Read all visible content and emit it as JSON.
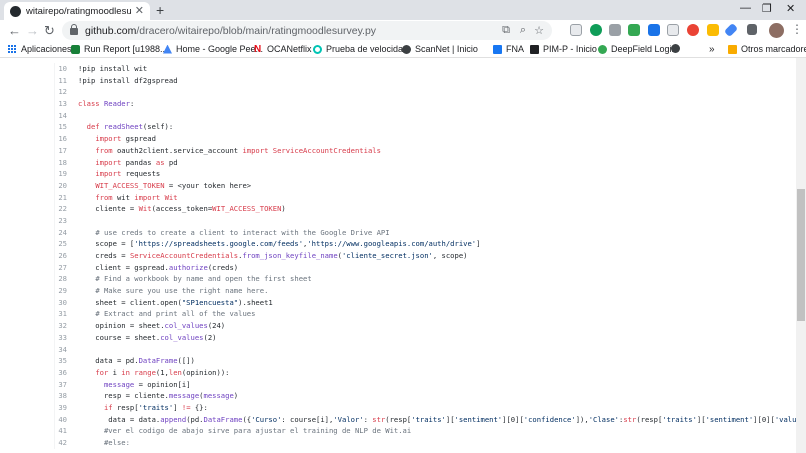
{
  "browser": {
    "tab_title": "witairepo/ratingmoodlesurvey.py",
    "url_host": "github.com",
    "url_path": "/dracero/witairepo/blob/main/ratingmoodlesurvey.py"
  },
  "bookmarks": [
    {
      "label": "Aplicaciones",
      "icon": "apps-grid-icon"
    },
    {
      "label": "Run Report [u1988...",
      "icon": "report-icon"
    },
    {
      "label": "Home - Google Pee...",
      "icon": "home-icon"
    },
    {
      "label": "OCANetflix",
      "icon": "netflix-icon"
    },
    {
      "label": "Prueba de velocida...",
      "icon": "speedtest-icon"
    },
    {
      "label": "ScanNet | Inicio",
      "icon": "scannet-icon"
    },
    {
      "label": "FNA",
      "icon": "facebook-icon"
    },
    {
      "label": "PIM-P - Inicio",
      "icon": "pim-icon"
    },
    {
      "label": "DeepField Login",
      "icon": "deepfield-icon"
    },
    {
      "label": "Otros marcadores",
      "icon": "folder-icon"
    }
  ],
  "code": {
    "lines": [
      {
        "n": "10",
        "text": "!pip install wit"
      },
      {
        "n": "11",
        "text": "!pip install df2gspread"
      },
      {
        "n": "12",
        "text": ""
      },
      {
        "n": "13",
        "text": "class Reader:"
      },
      {
        "n": "14",
        "text": ""
      },
      {
        "n": "15",
        "text": "  def readSheet(self):"
      },
      {
        "n": "16",
        "text": "    import gspread"
      },
      {
        "n": "17",
        "text": "    from oauth2client.service_account import ServiceAccountCredentials"
      },
      {
        "n": "18",
        "text": "    import pandas as pd"
      },
      {
        "n": "19",
        "text": "    import requests"
      },
      {
        "n": "20",
        "text": "    WIT_ACCESS_TOKEN = <your token here>"
      },
      {
        "n": "21",
        "text": "    from wit import Wit"
      },
      {
        "n": "22",
        "text": "    cliente = Wit(access_token=WIT_ACCESS_TOKEN)"
      },
      {
        "n": "23",
        "text": ""
      },
      {
        "n": "24",
        "text": "    # use creds to create a client to interact with the Google Drive API"
      },
      {
        "n": "25",
        "text": "    scope = ['https://spreadsheets.google.com/feeds','https://www.googleapis.com/auth/drive']"
      },
      {
        "n": "26",
        "text": "    creds = ServiceAccountCredentials.from_json_keyfile_name('cliente_secret.json', scope)"
      },
      {
        "n": "27",
        "text": "    client = gspread.authorize(creds)"
      },
      {
        "n": "28",
        "text": "    # Find a workbook by name and open the first sheet"
      },
      {
        "n": "29",
        "text": "    # Make sure you use the right name here."
      },
      {
        "n": "30",
        "text": "    sheet = client.open(\"SP1encuesta\").sheet1"
      },
      {
        "n": "31",
        "text": "    # Extract and print all of the values"
      },
      {
        "n": "32",
        "text": "    opinion = sheet.col_values(24)"
      },
      {
        "n": "33",
        "text": "    course = sheet.col_values(2)"
      },
      {
        "n": "34",
        "text": ""
      },
      {
        "n": "35",
        "text": "    data = pd.DataFrame([])"
      },
      {
        "n": "36",
        "text": "    for i in range(1,len(opinion)):"
      },
      {
        "n": "37",
        "text": "      message = opinion[i]"
      },
      {
        "n": "38",
        "text": "      resp = cliente.message(message)"
      },
      {
        "n": "39",
        "text": "      if resp['traits'] != {}:"
      },
      {
        "n": "40",
        "text": "       data = data.append(pd.DataFrame({'Curso': course[i],'Valor': str(resp['traits']['sentiment'][0]['confidence']),'Clase':str(resp['traits']['sentiment'][0]['value'])}, in"
      },
      {
        "n": "41",
        "text": "      #ver el codigo de abajo sirve para ajustar el training de NLP de Wit.ai"
      },
      {
        "n": "42",
        "text": "      #else:"
      }
    ]
  }
}
